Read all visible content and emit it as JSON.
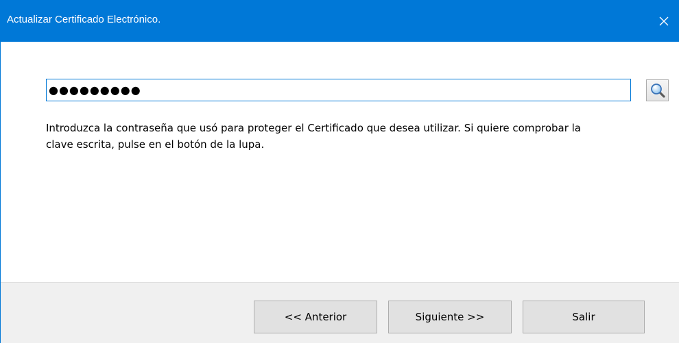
{
  "window": {
    "title": "Actualizar Certificado Electrónico."
  },
  "password": {
    "masked_value": "●●●●●●●●●"
  },
  "help": {
    "text": "Introduzca la contraseña que usó para proteger el Certificado que desea utilizar. Si quiere comprobar la clave escrita, pulse en el botón de la lupa."
  },
  "buttons": {
    "previous": "<< Anterior",
    "next": "Siguiente >>",
    "exit": "Salir"
  },
  "icons": {
    "close": "close-icon",
    "search": "magnifier-icon"
  },
  "colors": {
    "accent": "#0078d7",
    "footer": "#f0f0f0"
  }
}
